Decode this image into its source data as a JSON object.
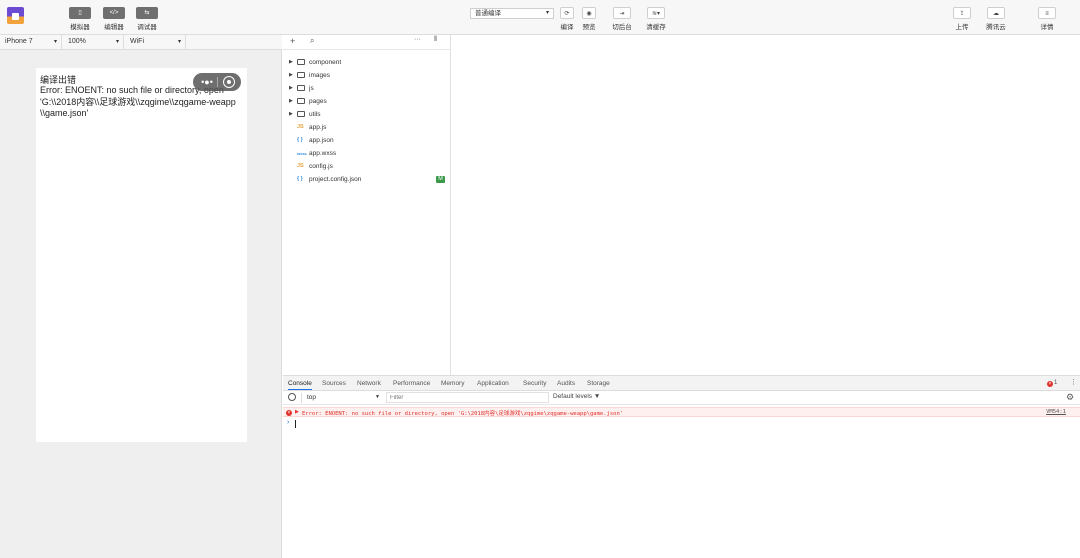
{
  "toolbar": {
    "simulator_label": "模拟器",
    "editor_label": "编辑器",
    "debugger_label": "调试器",
    "compile_mode": "普通编译",
    "compile_label": "编译",
    "preview_label": "预览",
    "background_label": "切后台",
    "clear_cache_label": "清缓存",
    "upload_label": "上传",
    "tencent_cloud_label": "腾讯云",
    "details_label": "详情"
  },
  "device_bar": {
    "device": "iPhone 7",
    "zoom": "100%",
    "network": "WiFi"
  },
  "simulator": {
    "error_title": "编译出错",
    "error_message": "Error: ENOENT: no such file or directory, open 'G:\\\\2018内容\\\\足球游戏\\\\zqgime\\\\zqgame-weapp\\\\game.json'"
  },
  "file_tree": {
    "folders": [
      "component",
      "images",
      "js",
      "pages",
      "utils"
    ],
    "files": [
      {
        "name": "app.js",
        "icon": "JS",
        "color": "#e8a33d"
      },
      {
        "name": "app.json",
        "icon": "{ }",
        "color": "#3a8ee6"
      },
      {
        "name": "app.wxss",
        "icon": "wxss",
        "color": "#3a8ee6"
      },
      {
        "name": "config.js",
        "icon": "JS",
        "color": "#e8a33d"
      },
      {
        "name": "project.config.json",
        "icon": "{ }",
        "color": "#3a8ee6",
        "badge": "M"
      }
    ]
  },
  "console": {
    "tabs": [
      "Console",
      "Sources",
      "Network",
      "Performance",
      "Memory",
      "Application",
      "Security",
      "Audits",
      "Storage"
    ],
    "context": "top",
    "filter_placeholder": "Filter",
    "levels": "Default levels ▼",
    "error_count": "1",
    "error_line": "Error: ENOENT: no such file or directory, open 'G:\\2018内容\\足球游戏\\zqgime\\zqgame-weapp\\game.json'",
    "error_source": "VM54:1"
  },
  "colors": {
    "error_red": "#e0302a",
    "modified_green": "#3a9a4a",
    "link_blue": "#1a73e8"
  }
}
